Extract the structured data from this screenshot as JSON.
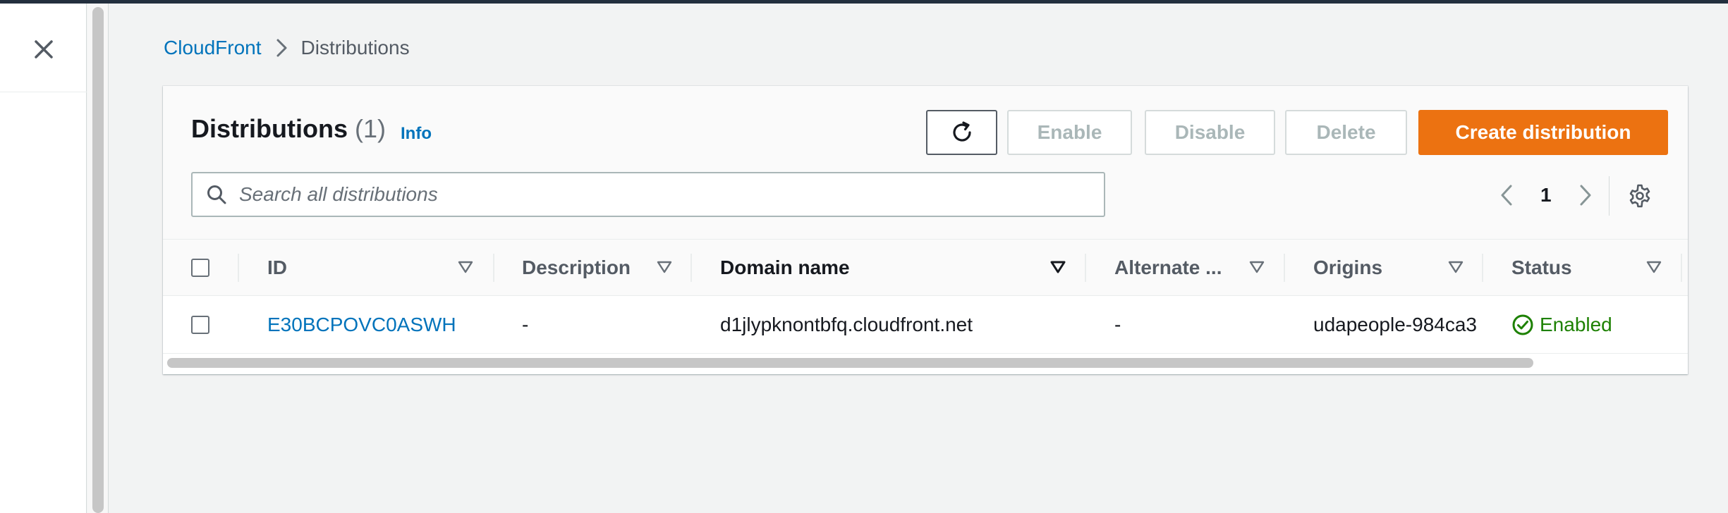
{
  "breadcrumb": {
    "root": "CloudFront",
    "current": "Distributions"
  },
  "panel": {
    "title": "Distributions",
    "count": "(1)",
    "info": "Info"
  },
  "actions": {
    "refresh_icon": "refresh-icon",
    "enable": "Enable",
    "disable": "Disable",
    "delete": "Delete",
    "create": "Create distribution",
    "create_color": "#ec7211"
  },
  "search": {
    "placeholder": "Search all distributions",
    "value": ""
  },
  "pagination": {
    "current_page": "1"
  },
  "table": {
    "columns": [
      "ID",
      "Description",
      "Domain name",
      "Alternate ...",
      "Origins",
      "Status"
    ],
    "rows": [
      {
        "id": "E30BCPOVC0ASWH",
        "description": "-",
        "domain_name": "d1jlypknontbfq.cloudfront.net",
        "alternate": "-",
        "origins": "udapeople-984ca3…",
        "status": "Enabled"
      }
    ]
  },
  "colors": {
    "link": "#0073bb",
    "status_enabled": "#1d8102",
    "header_bar": "#232f3e"
  }
}
